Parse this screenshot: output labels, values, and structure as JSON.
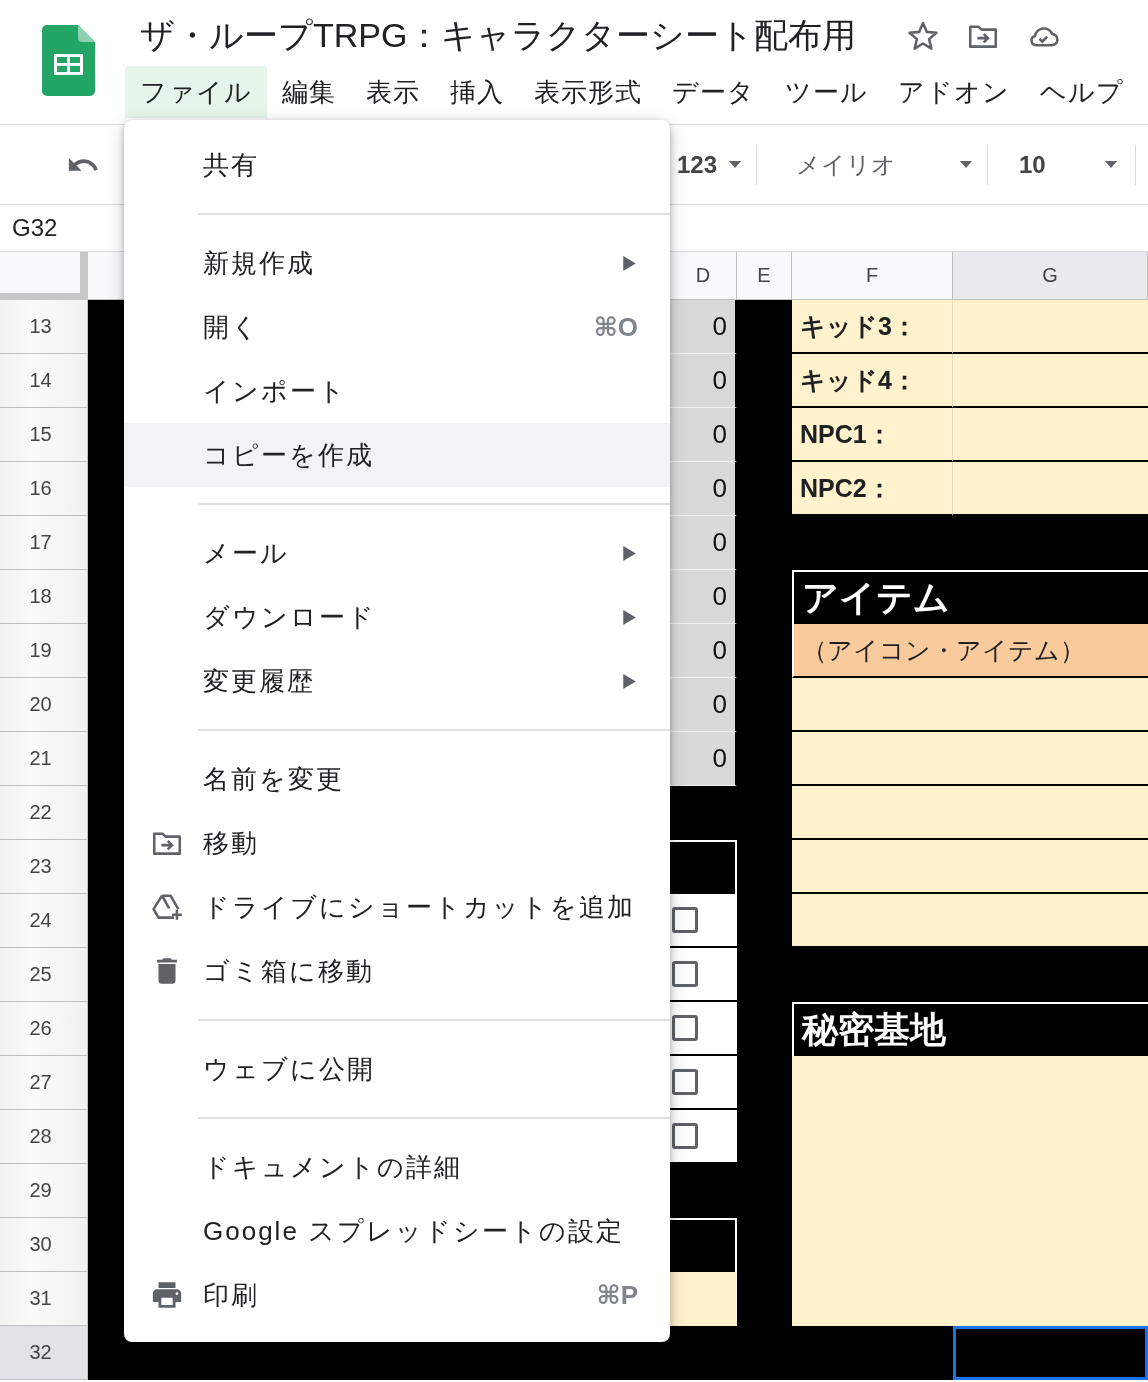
{
  "document": {
    "title": "ザ・ループTRPG：キャラクターシート配布用"
  },
  "menubar": [
    {
      "label": "ファイル",
      "selected": true
    },
    {
      "label": "編集",
      "selected": false
    },
    {
      "label": "表示",
      "selected": false
    },
    {
      "label": "挿入",
      "selected": false
    },
    {
      "label": "表示形式",
      "selected": false
    },
    {
      "label": "データ",
      "selected": false
    },
    {
      "label": "ツール",
      "selected": false
    },
    {
      "label": "アドオン",
      "selected": false
    },
    {
      "label": "ヘルプ",
      "selected": false
    }
  ],
  "toolbar": {
    "number_format": "123",
    "font": "メイリオ",
    "font_size": "10"
  },
  "name_box": "G32",
  "columns": [
    {
      "label": "D",
      "selected": false
    },
    {
      "label": "E",
      "selected": false
    },
    {
      "label": "F",
      "selected": false
    },
    {
      "label": "G",
      "selected": true
    }
  ],
  "rows": [
    {
      "number": "13",
      "selected": false,
      "d": {
        "kind": "number",
        "text": "0"
      },
      "fg": {
        "kind": "label",
        "text": "キッド3："
      }
    },
    {
      "number": "14",
      "selected": false,
      "d": {
        "kind": "number",
        "text": "0"
      },
      "fg": {
        "kind": "label",
        "text": "キッド4："
      }
    },
    {
      "number": "15",
      "selected": false,
      "d": {
        "kind": "number",
        "text": "0"
      },
      "fg": {
        "kind": "label",
        "text": "NPC1："
      }
    },
    {
      "number": "16",
      "selected": false,
      "d": {
        "kind": "number",
        "text": "0"
      },
      "fg": {
        "kind": "label",
        "text": "NPC2："
      }
    },
    {
      "number": "17",
      "selected": false,
      "d": {
        "kind": "number",
        "text": "0"
      },
      "fg": {
        "kind": "dark"
      }
    },
    {
      "number": "18",
      "selected": false,
      "d": {
        "kind": "number",
        "text": "0"
      },
      "fg": {
        "kind": "heading",
        "text": "アイテム"
      }
    },
    {
      "number": "19",
      "selected": false,
      "d": {
        "kind": "number",
        "text": "0"
      },
      "fg": {
        "kind": "note",
        "text": "（アイコン・アイテム）"
      }
    },
    {
      "number": "20",
      "selected": false,
      "d": {
        "kind": "number",
        "text": "0"
      },
      "fg": {
        "kind": "blank"
      }
    },
    {
      "number": "21",
      "selected": false,
      "d": {
        "kind": "number",
        "text": "0"
      },
      "fg": {
        "kind": "blank"
      }
    },
    {
      "number": "22",
      "selected": false,
      "d": {
        "kind": "dark"
      },
      "fg": {
        "kind": "blank"
      }
    },
    {
      "number": "23",
      "selected": false,
      "d": {
        "kind": "outlined"
      },
      "fg": {
        "kind": "blank"
      }
    },
    {
      "number": "24",
      "selected": false,
      "d": {
        "kind": "checkbox",
        "checked": false
      },
      "fg": {
        "kind": "blank"
      }
    },
    {
      "number": "25",
      "selected": false,
      "d": {
        "kind": "checkbox",
        "checked": false
      },
      "fg": {
        "kind": "dark"
      }
    },
    {
      "number": "26",
      "selected": false,
      "d": {
        "kind": "checkbox",
        "checked": false
      },
      "fg": {
        "kind": "heading",
        "text": "秘密基地"
      }
    },
    {
      "number": "27",
      "selected": false,
      "d": {
        "kind": "checkbox",
        "checked": false
      },
      "fg": {
        "kind": "continued"
      }
    },
    {
      "number": "28",
      "selected": false,
      "d": {
        "kind": "checkbox",
        "checked": false
      },
      "fg": {
        "kind": "continued"
      }
    },
    {
      "number": "29",
      "selected": false,
      "d": {
        "kind": "dark"
      },
      "fg": {
        "kind": "continued"
      }
    },
    {
      "number": "30",
      "selected": false,
      "d": {
        "kind": "outlined"
      },
      "fg": {
        "kind": "continued"
      }
    },
    {
      "number": "31",
      "selected": false,
      "d": {
        "kind": "cream"
      },
      "fg": {
        "kind": "continued"
      }
    },
    {
      "number": "32",
      "selected": true,
      "d": {
        "kind": "dark"
      },
      "fg": {
        "kind": "dark"
      }
    }
  ],
  "file_menu": [
    {
      "kind": "plain",
      "label": "共有",
      "highlighted": false
    },
    {
      "kind": "separator"
    },
    {
      "kind": "submenu",
      "label": "新規作成",
      "highlighted": false
    },
    {
      "kind": "plain",
      "label": "開く",
      "shortcut": "⌘O",
      "highlighted": false
    },
    {
      "kind": "plain",
      "label": "インポート",
      "highlighted": false
    },
    {
      "kind": "plain",
      "label": "コピーを作成",
      "highlighted": true
    },
    {
      "kind": "separator"
    },
    {
      "kind": "submenu",
      "label": "メール",
      "highlighted": false
    },
    {
      "kind": "submenu",
      "label": "ダウンロード",
      "highlighted": false
    },
    {
      "kind": "submenu",
      "label": "変更履歴",
      "highlighted": false
    },
    {
      "kind": "separator"
    },
    {
      "kind": "plain",
      "label": "名前を変更",
      "highlighted": false
    },
    {
      "kind": "folder",
      "label": "移動",
      "highlighted": false
    },
    {
      "kind": "drive",
      "label": "ドライブにショートカットを追加",
      "highlighted": false
    },
    {
      "kind": "trash",
      "label": "ゴミ箱に移動",
      "highlighted": false
    },
    {
      "kind": "separator"
    },
    {
      "kind": "plain",
      "label": "ウェブに公開",
      "highlighted": false
    },
    {
      "kind": "separator"
    },
    {
      "kind": "plain",
      "label": "ドキュメントの詳細",
      "highlighted": false
    },
    {
      "kind": "plain",
      "label": "Google スプレッドシートの設定",
      "highlighted": false
    },
    {
      "kind": "printer",
      "label": "印刷",
      "shortcut": "⌘P",
      "highlighted": false
    }
  ]
}
